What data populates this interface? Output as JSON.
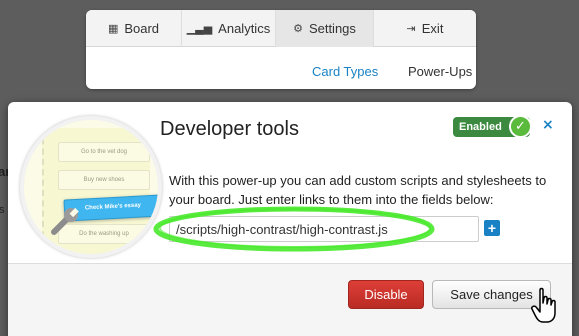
{
  "background": {
    "text_1": "ar",
    "text_2": "s"
  },
  "nav": {
    "tabs": [
      {
        "label": "Board",
        "icon": "board-icon"
      },
      {
        "label": "Analytics",
        "icon": "analytics-icon"
      },
      {
        "label": "Settings",
        "icon": "gear-icon",
        "active": true
      },
      {
        "label": "Exit",
        "icon": "exit-icon"
      }
    ],
    "subnav": {
      "card_types": "Card Types",
      "power_ups": "Power-Ups"
    }
  },
  "modal": {
    "title": "Developer tools",
    "badge": "Enabled",
    "close_label": "×",
    "description": "With this power-up you can add custom scripts and stylesheets to your board. Just enter links to them into the fields below:",
    "script_value": "/scripts/high-contrast/high-contrast.js",
    "add_label": "+",
    "illustration_cards": [
      "Go to the vet dog",
      "Buy new shoes",
      "Check Mike's essay",
      "Do the washing up"
    ],
    "disable_label": "Disable",
    "save_label": "Save changes"
  },
  "colors": {
    "accent": "#1a82c4",
    "danger": "#c9342d",
    "success": "#3c8a3f",
    "highlight": "#47e92a"
  }
}
